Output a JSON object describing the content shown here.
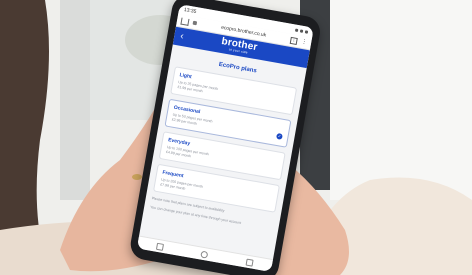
{
  "status": {
    "time": "13:35"
  },
  "browser": {
    "url": "ecopro.brother.co.uk"
  },
  "header": {
    "back": "‹",
    "logo": "brother",
    "tagline": "at your side"
  },
  "page": {
    "title": "EcoPro plans"
  },
  "plans": [
    {
      "name": "Light",
      "line1": "Up to 25 pages per month",
      "line2": "£1.99 per month",
      "selected": false
    },
    {
      "name": "Occasional",
      "line1": "Up to 50 pages per month",
      "line2": "£2.99 per month",
      "selected": true
    },
    {
      "name": "Everyday",
      "line1": "Up to 100 pages per month",
      "line2": "£4.99 per month",
      "selected": false
    },
    {
      "name": "Frequent",
      "line1": "Up to 200 pages per month",
      "line2": "£7.99 per month",
      "selected": false
    }
  ],
  "notes": [
    "Please note that plans are subject to availability",
    "You can change your plan at any time through your account"
  ],
  "colors": {
    "brand": "#1a48c4",
    "phone_body": "#1c1d20"
  }
}
